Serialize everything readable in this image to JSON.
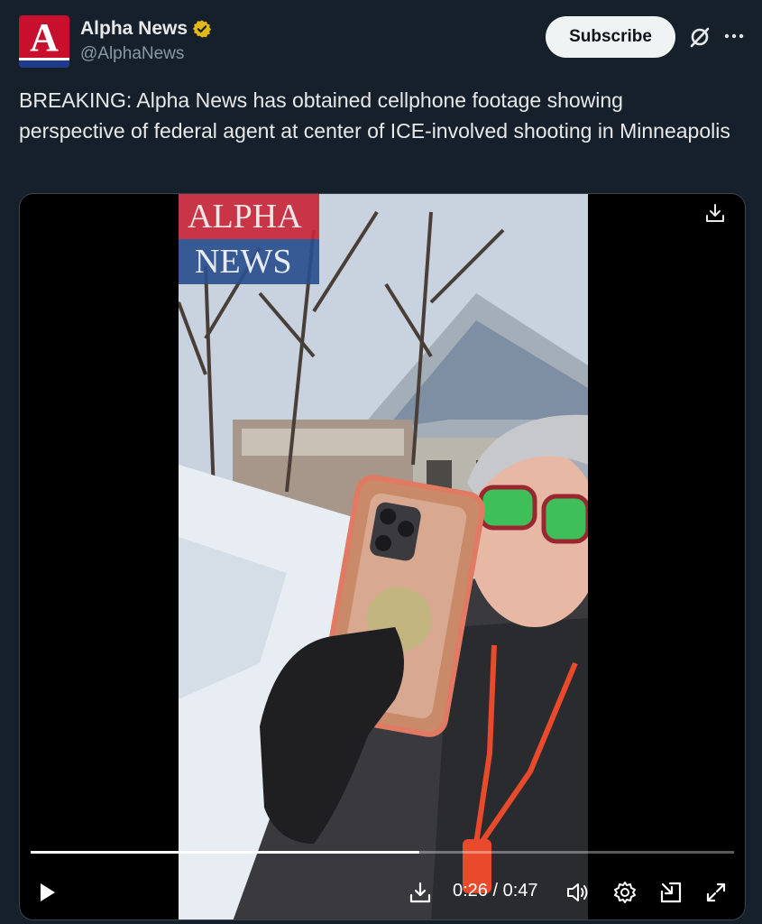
{
  "account": {
    "display_name": "Alpha News",
    "handle": "@AlphaNews",
    "avatar_letter": "A",
    "verified": true
  },
  "header": {
    "subscribe_label": "Subscribe",
    "grok_icon": "grok-icon",
    "more_icon": "more-icon"
  },
  "tweet": {
    "text": "BREAKING: Alpha News has obtained cellphone footage showing perspective of federal agent at center of ICE-involved shooting in Minneapolis"
  },
  "video": {
    "watermark_top": "ALPHA",
    "watermark_bottom": "NEWS",
    "current_time": "0:26",
    "duration": "0:47",
    "time_display": "0:26 / 0:47",
    "progress": 0.553,
    "icons": [
      "download-icon",
      "play-icon",
      "volume-icon",
      "settings-icon",
      "pip-icon",
      "fullscreen-icon"
    ]
  },
  "colors": {
    "background": "#15202b",
    "brand_red": "#c8102e",
    "brand_blue": "#1f3a8a",
    "verified_gold": "#e2b719"
  }
}
